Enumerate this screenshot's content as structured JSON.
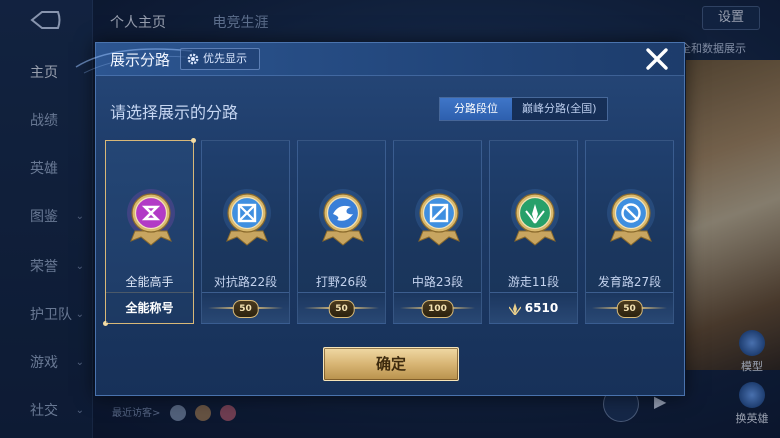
{
  "background": {
    "sidebar": [
      {
        "label": "主页",
        "active": true,
        "has_chevron": false
      },
      {
        "label": "战绩",
        "active": false,
        "has_chevron": false
      },
      {
        "label": "英雄",
        "active": false,
        "has_chevron": false
      },
      {
        "label": "图鉴",
        "active": false,
        "has_chevron": true
      },
      {
        "label": "荣誉",
        "active": false,
        "has_chevron": true
      },
      {
        "label": "护卫队",
        "active": false,
        "has_chevron": true
      },
      {
        "label": "游戏",
        "active": false,
        "has_chevron": true
      },
      {
        "label": "社交",
        "active": false,
        "has_chevron": true
      }
    ],
    "tabs": [
      {
        "label": "个人主页"
      },
      {
        "label": "电竞生涯"
      }
    ],
    "settings_label": "设置",
    "right_text": "全和数据展示",
    "recent_visitors_label": "最近访客>",
    "right_buttons": [
      {
        "label": "模型"
      },
      {
        "label": "换英雄"
      }
    ]
  },
  "modal": {
    "title": "展示分路",
    "priority_label": "优先显示",
    "subtitle": "请选择展示的分路",
    "segments": [
      {
        "label": "分路段位",
        "active": true
      },
      {
        "label": "巅峰分路(全国)",
        "active": false
      }
    ],
    "cards": [
      {
        "name": "全能高手",
        "footer": "全能称号",
        "footer_type": "text",
        "selected": true,
        "badge_color": "#b23ac6",
        "icon": "all-round-icon"
      },
      {
        "name": "对抗路22段",
        "footer": "50",
        "footer_type": "star",
        "selected": false,
        "badge_color": "#3f8fe0",
        "icon": "clash-lane-icon"
      },
      {
        "name": "打野26段",
        "footer": "50",
        "footer_type": "star",
        "selected": false,
        "badge_color": "#3a7fd8",
        "icon": "jungle-icon"
      },
      {
        "name": "中路23段",
        "footer": "100",
        "footer_type": "star",
        "selected": false,
        "badge_color": "#3f8fe0",
        "icon": "mid-lane-icon"
      },
      {
        "name": "游走11段",
        "footer": "6510",
        "footer_type": "peak",
        "selected": false,
        "badge_color": "#27a06a",
        "icon": "roam-icon"
      },
      {
        "name": "发育路27段",
        "footer": "50",
        "footer_type": "star",
        "selected": false,
        "badge_color": "#3f8fe0",
        "icon": "farm-lane-icon"
      }
    ],
    "confirm_label": "确定"
  }
}
